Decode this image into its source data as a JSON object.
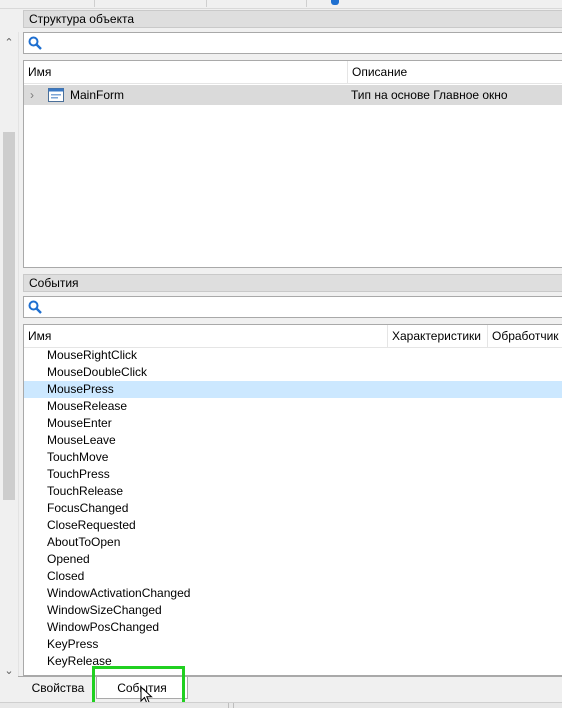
{
  "structure_panel": {
    "title": "Структура объекта",
    "search": {
      "value": "",
      "placeholder": ""
    },
    "columns": {
      "name": "Имя",
      "description": "Описание"
    },
    "rows": [
      {
        "name": "MainForm",
        "description": "Тип на основе Главное окно",
        "icon": "form-icon"
      }
    ]
  },
  "events_panel": {
    "title": "События",
    "search": {
      "value": "",
      "placeholder": ""
    },
    "columns": {
      "name": "Имя",
      "characteristics": "Характеристики",
      "handler": "Обработчик"
    },
    "selected_index": 2,
    "items": [
      "MouseRightClick",
      "MouseDoubleClick",
      "MousePress",
      "MouseRelease",
      "MouseEnter",
      "MouseLeave",
      "TouchMove",
      "TouchPress",
      "TouchRelease",
      "FocusChanged",
      "CloseRequested",
      "AboutToOpen",
      "Opened",
      "Closed",
      "WindowActivationChanged",
      "WindowSizeChanged",
      "WindowPosChanged",
      "KeyPress",
      "KeyRelease"
    ]
  },
  "tabs": {
    "properties": "Свойства",
    "events": "События",
    "active": "events"
  },
  "colors": {
    "selection": "#cce8ff",
    "highlight_box": "#20d020",
    "header_bg": "#dedede",
    "search_icon": "#1e6fd0"
  }
}
